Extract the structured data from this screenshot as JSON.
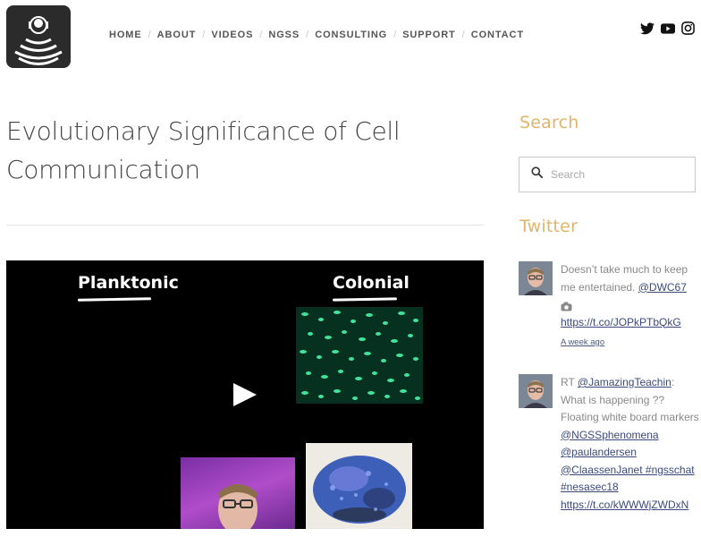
{
  "header": {
    "nav": [
      {
        "label": "HOME"
      },
      {
        "label": "ABOUT"
      },
      {
        "label": "VIDEOS"
      },
      {
        "label": "NGSS"
      },
      {
        "label": "CONSULTING"
      },
      {
        "label": "SUPPORT"
      },
      {
        "label": "CONTACT"
      }
    ],
    "social_icons": [
      "twitter-icon",
      "youtube-icon",
      "instagram-icon"
    ]
  },
  "post": {
    "title_line1": "Evolutionary Significance of Cell",
    "title_line2": "Communication",
    "video": {
      "label_left": "Planktonic",
      "label_right": "Colonial"
    }
  },
  "sidebar": {
    "search_heading": "Search",
    "search_placeholder": "Search",
    "twitter_heading": "Twitter",
    "tweets": [
      {
        "text": "Doesn’t take much to keep me entertained. ",
        "mention": "@DWC67",
        "link": "https://t.co/JOPkPTbQkG",
        "time": "A week ago"
      },
      {
        "prefix": "RT ",
        "mention": "@JamazingTeachin",
        "text": ": What is happening ?? Floating white board markers",
        "mention2": "@NGSSphenomena",
        "mention3": "@paulandersen",
        "mention4": "@ClaassenJanet",
        "hashtag1": " #ngsschat",
        "hashtag2": "#nesasec18",
        "link": "https://t.co/kWWWjZWDxN"
      }
    ]
  },
  "colors": {
    "accent": "#e0b56b",
    "link": "#3a4a7a",
    "nav_text": "#555555"
  }
}
